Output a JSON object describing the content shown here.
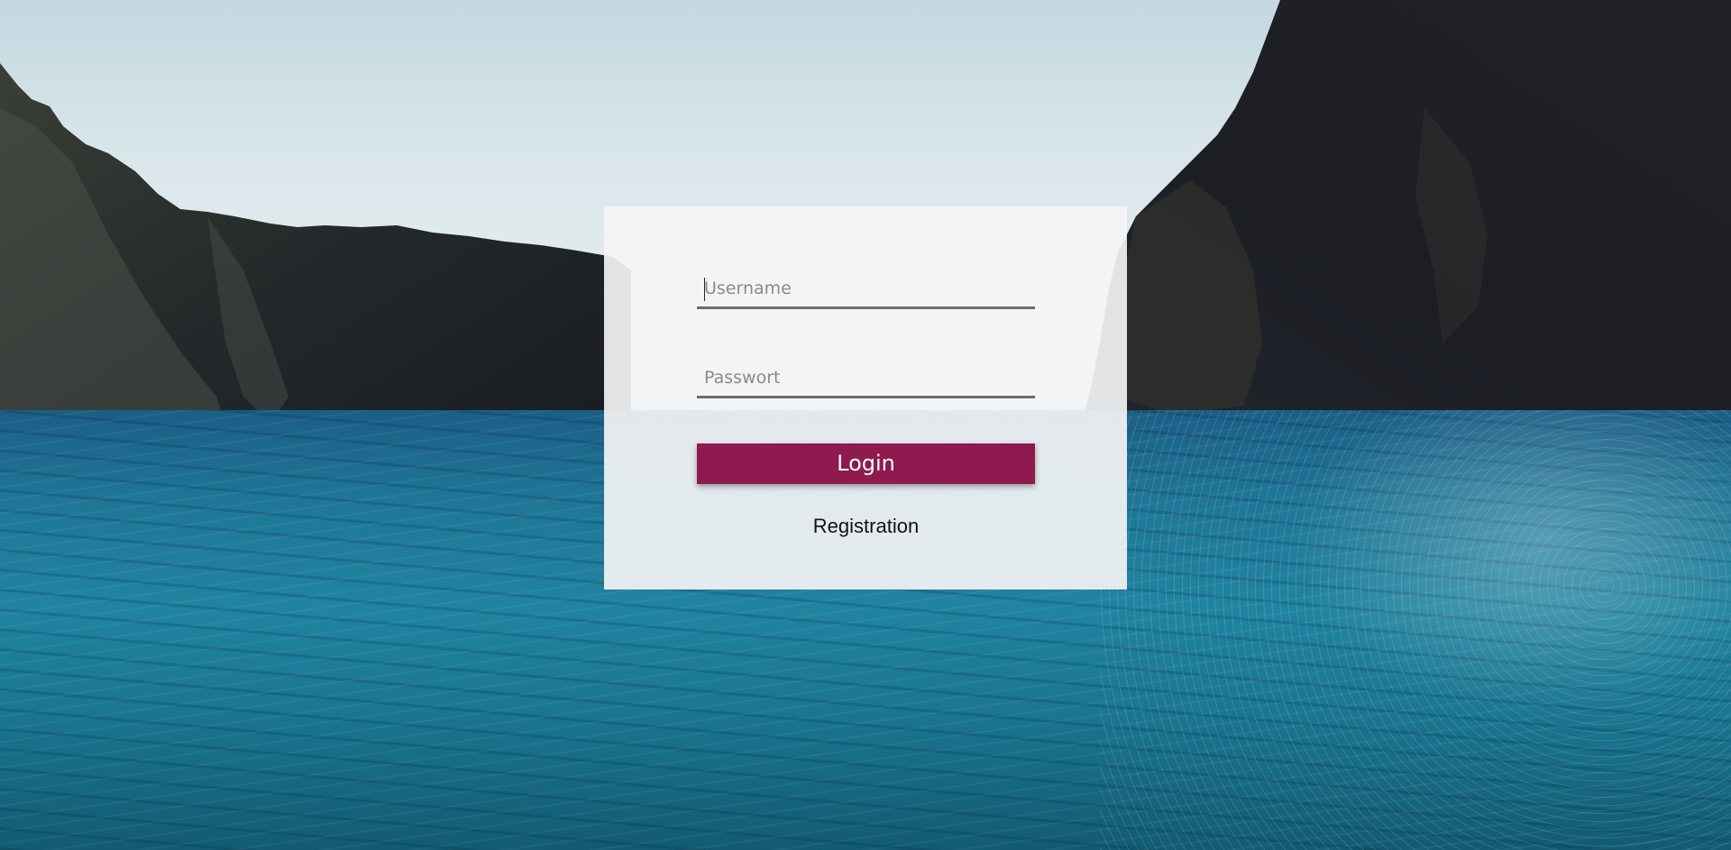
{
  "login_form": {
    "username": {
      "placeholder": "Username",
      "value": ""
    },
    "password": {
      "placeholder": "Passwort",
      "value": ""
    },
    "login_label": "Login",
    "registration_label": "Registration"
  },
  "colors": {
    "button_background": "#8e1a50",
    "button_text": "#ffffff",
    "card_background": "#f4f4f5",
    "input_underline": "#6b6b6b"
  },
  "background": {
    "scene": "sea-between-cliffs-photo"
  }
}
